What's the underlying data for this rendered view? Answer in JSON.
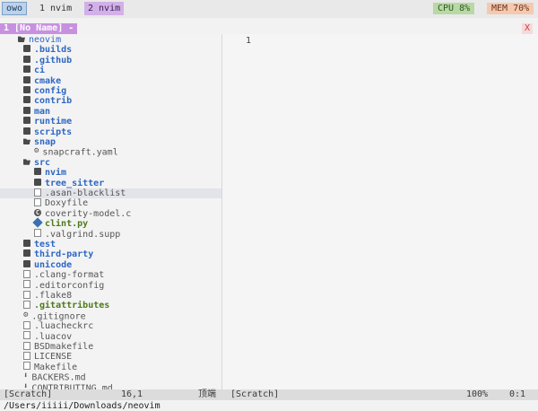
{
  "topbar": {
    "active_ws": "owo",
    "ws1": "1 nvim",
    "ws2": "2 nvim",
    "cpu": "CPU  8%",
    "mem": "MEM 70%"
  },
  "tabline": {
    "tab": "1 [No Name] -",
    "close": "X"
  },
  "tree": [
    {
      "label": "neovim",
      "kind": "root"
    },
    {
      "label": ".builds",
      "kind": "dir"
    },
    {
      "label": ".github",
      "kind": "dir"
    },
    {
      "label": "ci",
      "kind": "dir"
    },
    {
      "label": "cmake",
      "kind": "dir"
    },
    {
      "label": "config",
      "kind": "dir"
    },
    {
      "label": "contrib",
      "kind": "dir"
    },
    {
      "label": "man",
      "kind": "dir"
    },
    {
      "label": "runtime",
      "kind": "dir"
    },
    {
      "label": "scripts",
      "kind": "dir"
    },
    {
      "label": "snap",
      "kind": "diropen"
    },
    {
      "label": "snapcraft.yaml",
      "kind": "gear",
      "indent": 2
    },
    {
      "label": "src",
      "kind": "diropen"
    },
    {
      "label": "nvim",
      "kind": "dir",
      "indent": 2
    },
    {
      "label": "tree_sitter",
      "kind": "dir",
      "indent": 2
    },
    {
      "label": ".asan-blacklist",
      "kind": "file",
      "indent": 2,
      "hl": true
    },
    {
      "label": "Doxyfile",
      "kind": "file",
      "indent": 2
    },
    {
      "label": "coverity-model.c",
      "kind": "c",
      "indent": 2
    },
    {
      "label": "clint.py",
      "kind": "py",
      "indent": 2
    },
    {
      "label": ".valgrind.supp",
      "kind": "file",
      "indent": 2
    },
    {
      "label": "test",
      "kind": "dir"
    },
    {
      "label": "third-party",
      "kind": "dir"
    },
    {
      "label": "unicode",
      "kind": "dir"
    },
    {
      "label": ".clang-format",
      "kind": "file"
    },
    {
      "label": ".editorconfig",
      "kind": "file"
    },
    {
      "label": ".flake8",
      "kind": "file"
    },
    {
      "label": ".gitattributes",
      "kind": "ga"
    },
    {
      "label": ".gitignore",
      "kind": "gear"
    },
    {
      "label": ".luacheckrc",
      "kind": "file"
    },
    {
      "label": ".luacov",
      "kind": "file"
    },
    {
      "label": "BSDmakefile",
      "kind": "file"
    },
    {
      "label": "LICENSE",
      "kind": "file"
    },
    {
      "label": "Makefile",
      "kind": "file"
    },
    {
      "label": "BACKERS.md",
      "kind": "arrow"
    },
    {
      "label": "CONTRIBUTING.md",
      "kind": "arrow"
    }
  ],
  "editor": {
    "line_number": "1"
  },
  "statusbar": {
    "left_buffer": "[Scratch]",
    "left_pos": "16,1",
    "left_loc": "顶端",
    "right_buffer": "[Scratch]",
    "right_pct": "100%",
    "right_pos": "0:1"
  },
  "cmdline": "/Users/iiiii/Downloads/neovim"
}
